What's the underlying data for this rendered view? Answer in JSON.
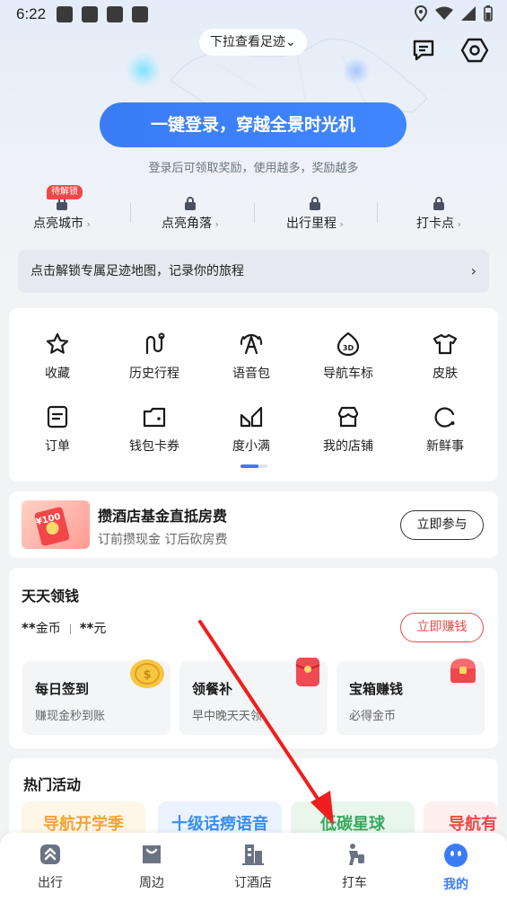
{
  "status_bar": {
    "time": "6:22"
  },
  "header": {
    "pull_hint": "下拉查看足迹⌄"
  },
  "login": {
    "button_label": "一键登录，穿越全景时光机",
    "subtitle": "登录后可领取奖励，使用越多，奖励越多"
  },
  "stats": {
    "badge": "待解锁",
    "items": [
      {
        "label": "点亮城市"
      },
      {
        "label": "点亮角落"
      },
      {
        "label": "出行里程"
      },
      {
        "label": "打卡点"
      }
    ]
  },
  "unlock_banner": {
    "text": "点击解锁专属足迹地图，记录你的旅程",
    "arrow": "›"
  },
  "tools": [
    {
      "label": "收藏",
      "icon": "star-icon"
    },
    {
      "label": "历史行程",
      "icon": "route-icon"
    },
    {
      "label": "语音包",
      "icon": "voice-pack-icon"
    },
    {
      "label": "导航车标",
      "icon": "3d-car-icon"
    },
    {
      "label": "皮肤",
      "icon": "shirt-icon"
    },
    {
      "label": "订单",
      "icon": "order-icon"
    },
    {
      "label": "钱包卡券",
      "icon": "wallet-icon"
    },
    {
      "label": "度小满",
      "icon": "du-xiaoman-icon"
    },
    {
      "label": "我的店铺",
      "icon": "shop-icon"
    },
    {
      "label": "新鲜事",
      "icon": "news-icon"
    }
  ],
  "hotel_promo": {
    "title": "攒酒店基金直抵房费",
    "subtitle": "订前攒现金  订后砍房费",
    "button": "立即参与",
    "thumb_text": "¥100"
  },
  "daily_earn": {
    "title": "天天领钱",
    "coins_value": "**",
    "coins_unit": "金币",
    "cash_value": "**",
    "cash_unit": "元",
    "button": "立即赚钱",
    "tasks": [
      {
        "title": "每日签到",
        "subtitle": "赚现金秒到账"
      },
      {
        "title": "领餐补",
        "subtitle": "早中晚天天领"
      },
      {
        "title": "宝箱赚钱",
        "subtitle": "必得金币"
      }
    ]
  },
  "hot_events": {
    "title": "热门活动",
    "items": [
      {
        "label": "导航开学季",
        "color": "#f4a33a"
      },
      {
        "label": "十级话痨语音",
        "color": "#3b8df5"
      },
      {
        "label": "低碳星球",
        "color": "#3aa860"
      },
      {
        "label": "导航有",
        "color": "#f04848"
      }
    ]
  },
  "tab_bar": {
    "items": [
      {
        "label": "出行",
        "icon": "travel-icon"
      },
      {
        "label": "周边",
        "icon": "nearby-icon"
      },
      {
        "label": "订酒店",
        "icon": "hotel-icon"
      },
      {
        "label": "打车",
        "icon": "taxi-icon"
      },
      {
        "label": "我的",
        "icon": "profile-icon"
      }
    ],
    "active": "我的"
  },
  "colors": {
    "primary": "#3b7cf5",
    "accent_red": "#f04848",
    "annotation_arrow": "#f01e1e"
  }
}
